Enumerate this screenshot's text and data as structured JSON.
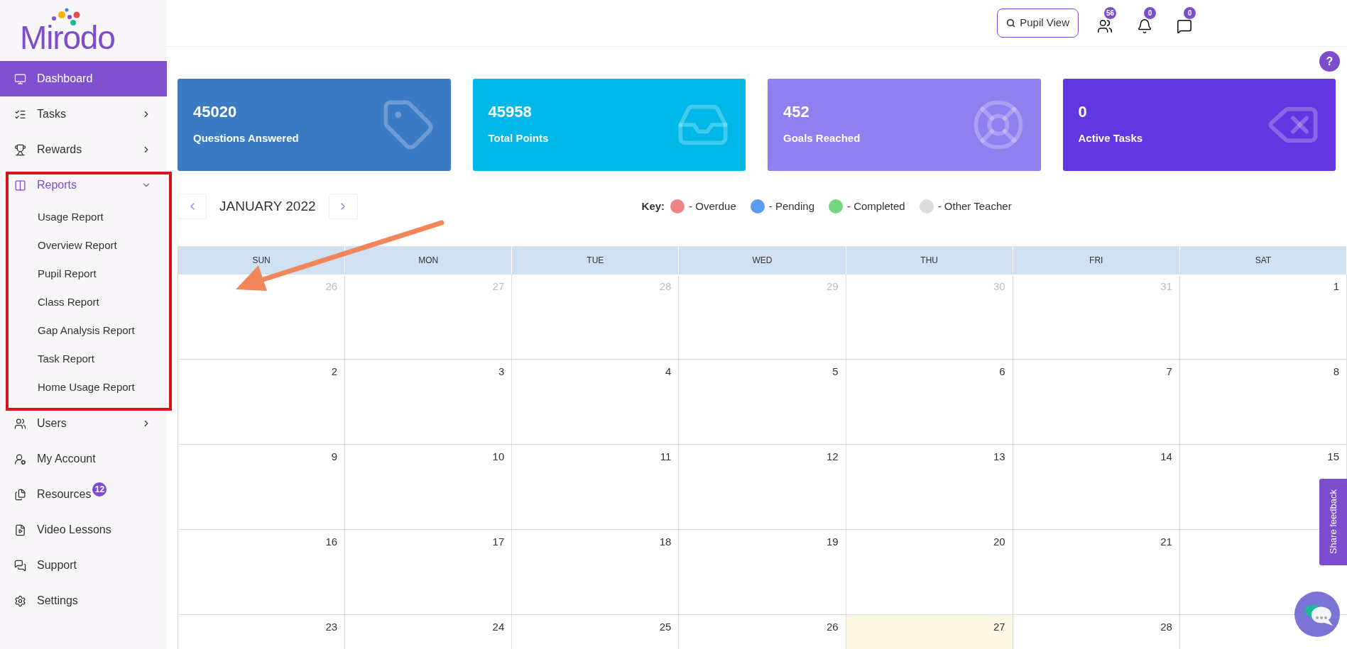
{
  "logo": {
    "text": "Mirodo"
  },
  "header": {
    "pupil_view": "Pupil View",
    "badges": [
      {
        "kind": "users",
        "count": "56"
      },
      {
        "kind": "bell",
        "count": "0"
      },
      {
        "kind": "chat",
        "count": "0"
      }
    ]
  },
  "help": "?",
  "sidebar": {
    "items": [
      {
        "label": "Dashboard",
        "selected": true
      },
      {
        "label": "Tasks",
        "selected": false,
        "expanded": false
      },
      {
        "label": "Rewards",
        "selected": false,
        "expanded": false
      },
      {
        "label": "Reports",
        "selected": false,
        "expanded": true,
        "children": [
          {
            "label": "Usage Report"
          },
          {
            "label": "Overview Report"
          },
          {
            "label": "Pupil Report"
          },
          {
            "label": "Class Report"
          },
          {
            "label": "Gap Analysis Report"
          },
          {
            "label": "Task Report"
          },
          {
            "label": "Home Usage Report"
          }
        ]
      },
      {
        "label": "Users",
        "selected": false,
        "expanded": false
      },
      {
        "label": "My Account",
        "selected": false
      },
      {
        "label": "Resources",
        "selected": false,
        "badge": "12"
      },
      {
        "label": "Video Lessons",
        "selected": false
      },
      {
        "label": "Support",
        "selected": false
      },
      {
        "label": "Settings",
        "selected": false
      }
    ]
  },
  "stats": [
    {
      "value": "45020",
      "label": "Questions Answered",
      "color": "#3b7bc4"
    },
    {
      "value": "45958",
      "label": "Total Points",
      "color": "#00b8e8"
    },
    {
      "value": "452",
      "label": "Goals Reached",
      "color": "#8f7fef"
    },
    {
      "value": "0",
      "label": "Active Tasks",
      "color": "#6236e0"
    }
  ],
  "calendar": {
    "month": "JANUARY 2022",
    "key_label": "Key:",
    "legend": [
      {
        "label": "- Overdue",
        "color": "#f08383"
      },
      {
        "label": "- Pending",
        "color": "#5b9bf0"
      },
      {
        "label": "- Completed",
        "color": "#74d67a"
      },
      {
        "label": "- Other Teacher",
        "color": "#dcdcdc"
      }
    ],
    "weekdays": [
      "SUN",
      "MON",
      "TUE",
      "WED",
      "THU",
      "FRI",
      "SAT"
    ],
    "weeks": [
      [
        {
          "day": "26",
          "muted": true
        },
        {
          "day": "27",
          "muted": true
        },
        {
          "day": "28",
          "muted": true
        },
        {
          "day": "29",
          "muted": true
        },
        {
          "day": "30",
          "muted": true
        },
        {
          "day": "31",
          "muted": true
        },
        {
          "day": "1",
          "muted": false
        }
      ],
      [
        {
          "day": "2",
          "muted": false
        },
        {
          "day": "3",
          "muted": false
        },
        {
          "day": "4",
          "muted": false
        },
        {
          "day": "5",
          "muted": false
        },
        {
          "day": "6",
          "muted": false
        },
        {
          "day": "7",
          "muted": false
        },
        {
          "day": "8",
          "muted": false
        }
      ],
      [
        {
          "day": "9",
          "muted": false
        },
        {
          "day": "10",
          "muted": false
        },
        {
          "day": "11",
          "muted": false
        },
        {
          "day": "12",
          "muted": false
        },
        {
          "day": "13",
          "muted": false
        },
        {
          "day": "14",
          "muted": false
        },
        {
          "day": "15",
          "muted": false
        }
      ],
      [
        {
          "day": "16",
          "muted": false
        },
        {
          "day": "17",
          "muted": false
        },
        {
          "day": "18",
          "muted": false
        },
        {
          "day": "19",
          "muted": false
        },
        {
          "day": "20",
          "muted": false
        },
        {
          "day": "21",
          "muted": false
        }
      ],
      [
        {
          "day": "23",
          "muted": false
        },
        {
          "day": "24",
          "muted": false
        },
        {
          "day": "25",
          "muted": false
        },
        {
          "day": "26",
          "muted": false
        },
        {
          "day": "27",
          "muted": false,
          "today": true
        },
        {
          "day": "28",
          "muted": false
        }
      ]
    ]
  },
  "feedback": {
    "label": "Share feedback"
  }
}
